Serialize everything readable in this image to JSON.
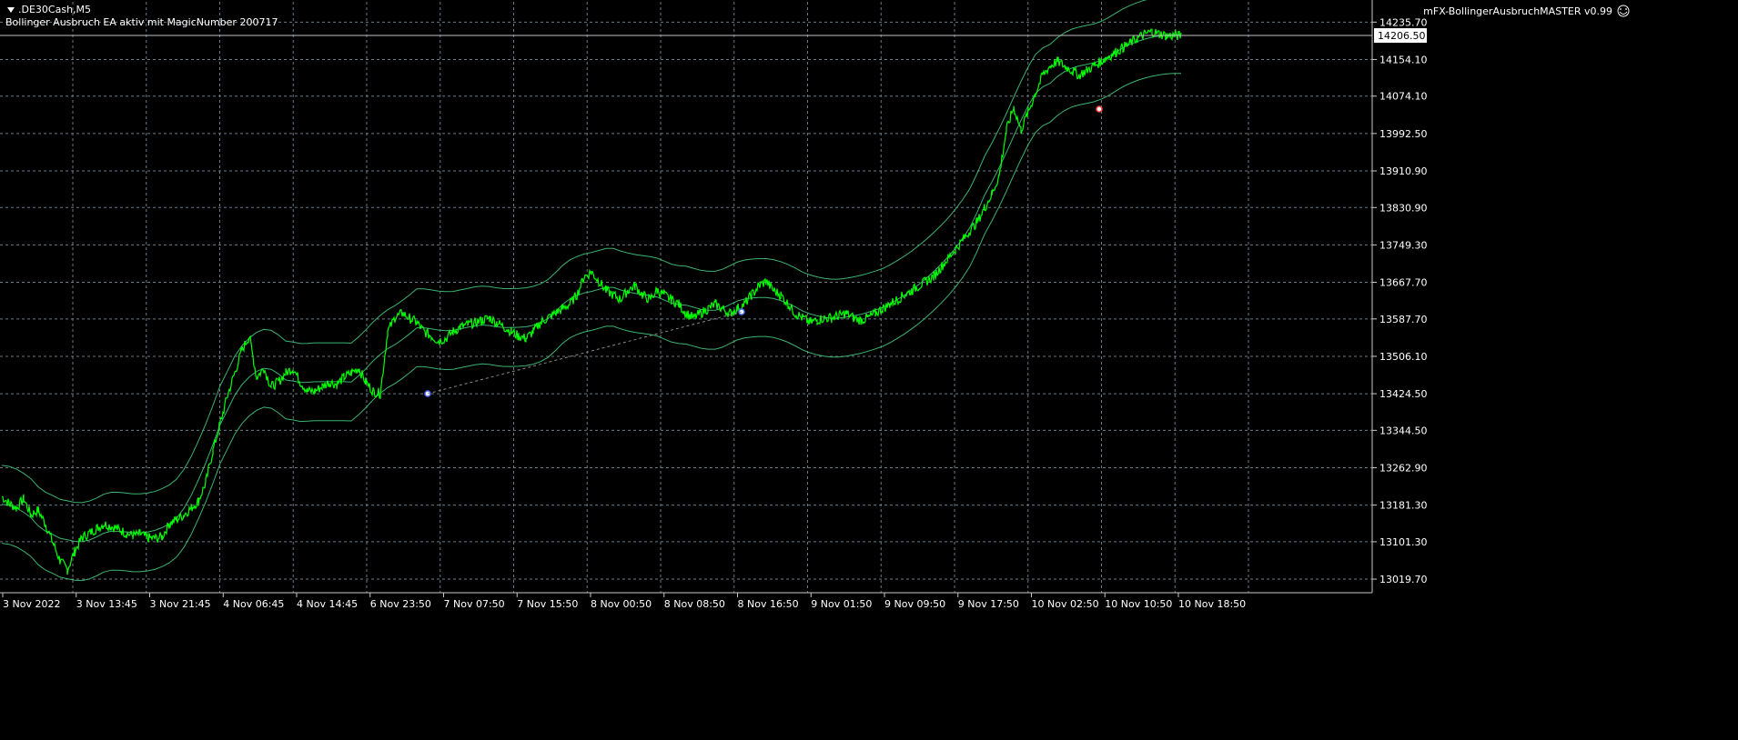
{
  "symbol_label": ".DE30Cash,M5",
  "ea_status": "Bollinger Ausbruch EA aktiv mit MagicNumber 200717",
  "ea_name": "mFX-BollingerAusbruchMASTER v0.99",
  "colors": {
    "background": "#000000",
    "grid": "#6b7b86",
    "axis": "#c8c8c8",
    "price": "#00ff00",
    "bands": "#3cb371",
    "text": "#ffffff",
    "current_price_line": "#c0c0c0"
  },
  "chart_data": {
    "type": "line",
    "title": "",
    "y_ticks": [
      "14235.70",
      "14154.10",
      "14074.10",
      "13992.50",
      "13910.90",
      "13830.90",
      "13749.30",
      "13667.70",
      "13587.70",
      "13506.10",
      "13424.50",
      "13344.50",
      "13262.90",
      "13181.30",
      "13101.30",
      "13019.70"
    ],
    "x_ticks": [
      "3 Nov 2022",
      "3 Nov 13:45",
      "3 Nov 21:45",
      "4 Nov 06:45",
      "4 Nov 14:45",
      "6 Nov 23:50",
      "7 Nov 07:50",
      "7 Nov 15:50",
      "8 Nov 00:50",
      "8 Nov 08:50",
      "8 Nov 16:50",
      "9 Nov 01:50",
      "9 Nov 09:50",
      "9 Nov 17:50",
      "10 Nov 02:50",
      "10 Nov 10:50",
      "10 Nov 18:50"
    ],
    "current_price": "14206.50",
    "ylim": [
      12990,
      14280
    ],
    "grid": true,
    "series": [
      {
        "x": [
          0,
          1,
          2,
          3,
          4,
          5,
          6,
          7,
          8,
          9,
          10,
          11,
          12,
          13,
          14,
          15,
          16,
          17,
          18,
          19,
          20,
          21,
          22,
          23,
          24,
          25,
          26,
          27,
          28,
          29,
          30,
          31,
          32,
          33,
          34,
          35,
          36,
          37,
          38,
          39,
          40,
          41,
          42,
          43,
          44,
          45,
          46,
          47,
          48,
          49,
          50,
          51,
          52,
          53,
          54,
          55,
          56,
          57,
          58,
          59,
          60,
          61,
          62,
          63,
          64,
          65,
          66,
          67,
          68,
          69,
          70,
          71,
          72,
          73,
          74,
          75,
          76,
          77,
          78,
          79,
          80,
          81,
          82,
          83,
          84,
          85,
          86,
          87,
          88,
          89,
          90,
          91,
          92,
          93,
          94,
          95,
          96,
          97,
          98,
          99,
          100,
          101,
          102,
          103,
          104,
          105,
          106,
          107,
          108,
          109,
          110,
          111,
          112,
          113,
          114,
          115,
          116,
          117,
          118,
          119,
          120,
          121,
          122,
          123,
          124,
          125,
          126,
          127,
          128,
          129,
          130,
          131,
          132,
          133,
          134,
          135,
          136,
          137,
          138,
          139,
          140,
          141,
          142,
          143,
          144,
          145,
          146,
          147,
          148,
          149,
          150,
          151,
          152,
          153,
          154,
          155,
          156,
          157,
          158,
          159,
          160,
          161,
          162
        ],
        "values": [
          13200,
          13185,
          13175,
          13195,
          13160,
          13170,
          13140,
          13100,
          13060,
          13040,
          13080,
          13110,
          13120,
          13130,
          13140,
          13135,
          13130,
          13120,
          13115,
          13118,
          13110,
          13108,
          13112,
          13140,
          13150,
          13160,
          13175,
          13190,
          13230,
          13300,
          13360,
          13420,
          13470,
          13520,
          13550,
          13460,
          13480,
          13440,
          13450,
          13470,
          13480,
          13450,
          13430,
          13430,
          13440,
          13450,
          13445,
          13460,
          13470,
          13480,
          13450,
          13430,
          13425,
          13560,
          13590,
          13600,
          13590,
          13580,
          13560,
          13550,
          13540,
          13545,
          13560,
          13570,
          13575,
          13580,
          13585,
          13590,
          13580,
          13570,
          13560,
          13550,
          13545,
          13560,
          13580,
          13590,
          13600,
          13610,
          13620,
          13640,
          13680,
          13690,
          13670,
          13650,
          13640,
          13630,
          13650,
          13660,
          13640,
          13630,
          13650,
          13640,
          13630,
          13620,
          13600,
          13590,
          13600,
          13610,
          13620,
          13610,
          13600,
          13610,
          13620,
          13640,
          13660,
          13670,
          13650,
          13640,
          13620,
          13600,
          13590,
          13580,
          13585,
          13590,
          13590,
          13595,
          13600,
          13590,
          13585,
          13590,
          13600,
          13610,
          13620,
          13630,
          13640,
          13650,
          13660,
          13670,
          13680,
          13700,
          13720,
          13740,
          13760,
          13780,
          13800,
          13830,
          13860,
          13900,
          14000,
          14050,
          14000,
          14040,
          14080,
          14120,
          14140,
          14150,
          14140,
          14130,
          14120,
          14130,
          14140,
          14150,
          14160,
          14170,
          14180,
          14190,
          14200,
          14210,
          14215,
          14210,
          14206,
          14206,
          14206
        ],
        "color": "#00ff00"
      }
    ]
  }
}
